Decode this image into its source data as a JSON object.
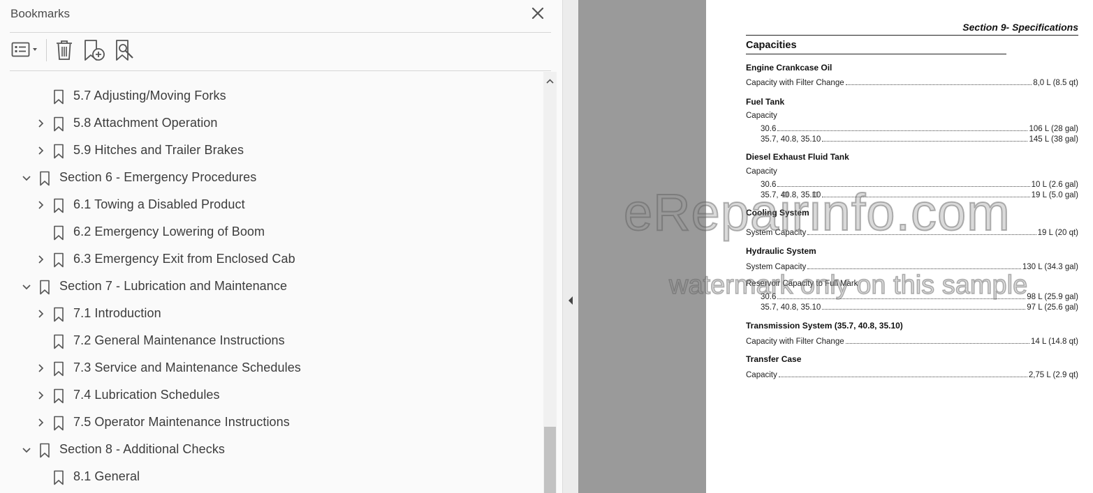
{
  "bookmarks_panel": {
    "title": "Bookmarks",
    "toolbar": {
      "options_icon": "list-options-icon",
      "delete_icon": "trash-icon",
      "new_bookmark_icon": "add-bookmark-icon",
      "find_bookmark_icon": "find-current-bookmark-icon"
    },
    "items": [
      {
        "label": "5.7 Adjusting/Moving Forks",
        "level": 1,
        "expander": "none"
      },
      {
        "label": "5.8 Attachment Operation",
        "level": 1,
        "expander": "collapsed"
      },
      {
        "label": "5.9 Hitches and Trailer Brakes",
        "level": 1,
        "expander": "collapsed"
      },
      {
        "label": "Section 6 - Emergency Procedures",
        "level": 0,
        "expander": "expanded"
      },
      {
        "label": "6.1 Towing a Disabled Product",
        "level": 1,
        "expander": "collapsed"
      },
      {
        "label": "6.2 Emergency Lowering of Boom",
        "level": 1,
        "expander": "none"
      },
      {
        "label": "6.3 Emergency Exit from Enclosed Cab",
        "level": 1,
        "expander": "collapsed"
      },
      {
        "label": "Section 7 - Lubrication and Maintenance",
        "level": 0,
        "expander": "expanded"
      },
      {
        "label": "7.1 Introduction",
        "level": 1,
        "expander": "collapsed"
      },
      {
        "label": "7.2 General Maintenance Instructions",
        "level": 1,
        "expander": "none"
      },
      {
        "label": "7.3 Service and Maintenance Schedules",
        "level": 1,
        "expander": "collapsed"
      },
      {
        "label": "7.4 Lubrication Schedules",
        "level": 1,
        "expander": "collapsed"
      },
      {
        "label": "7.5 Operator Maintenance Instructions",
        "level": 1,
        "expander": "collapsed"
      },
      {
        "label": "Section 8 - Additional Checks",
        "level": 0,
        "expander": "expanded"
      },
      {
        "label": "8.1 General",
        "level": 1,
        "expander": "none"
      }
    ]
  },
  "document": {
    "section_header": "Section 9- Specifications",
    "title": "Capacities",
    "groups": [
      {
        "heading": "Engine Crankcase Oil",
        "lines": [
          {
            "key": "Capacity with Filter Change",
            "value": "8,0 L (8.5 qt)"
          }
        ]
      },
      {
        "heading": "Fuel Tank",
        "sublabel": "Capacity",
        "lines": [
          {
            "key": "30.6",
            "value": "106 L (28 gal)"
          },
          {
            "key": "35.7, 40.8, 35.10",
            "value": "145 L (38 gal)"
          }
        ]
      },
      {
        "heading": "Diesel Exhaust Fluid Tank",
        "sublabel": "Capacity",
        "lines": [
          {
            "key": "30.6",
            "value": "10 L (2.6 gal)"
          },
          {
            "key": "35.7, 40.8, 35.10",
            "value": "19 L (5.0 gal)"
          }
        ]
      },
      {
        "heading": "Cooling System",
        "lines": [
          {
            "key": "System Capacity",
            "value": "19 L (20 qt)"
          }
        ]
      },
      {
        "heading": "Hydraulic System",
        "lines": [
          {
            "key": "System Capacity",
            "value": "130 L (34.3 gal)"
          }
        ],
        "sublabel2": "Reservoir Capacity to Full Mark",
        "lines2": [
          {
            "key": "30.6",
            "value": "98 L (25.9 gal)"
          },
          {
            "key": "35.7, 40.8, 35.10",
            "value": "97 L (25.6 gal)"
          }
        ]
      },
      {
        "heading": "Transmission System (35.7, 40.8, 35.10)",
        "lines": [
          {
            "key": "Capacity with Filter Change",
            "value": "14 L (14.8 qt)"
          }
        ]
      },
      {
        "heading": "Transfer Case",
        "lines": [
          {
            "key": "Capacity",
            "value": "2,75 L (2.9 qt)"
          }
        ]
      }
    ]
  },
  "watermark": {
    "line1": "eRepairinfo.com",
    "line2": "watermark only on this sample"
  },
  "colors": {
    "panel_bg": "#fafafa",
    "gutter_gray": "#9a9a9a",
    "text": "#3c3c3c"
  }
}
